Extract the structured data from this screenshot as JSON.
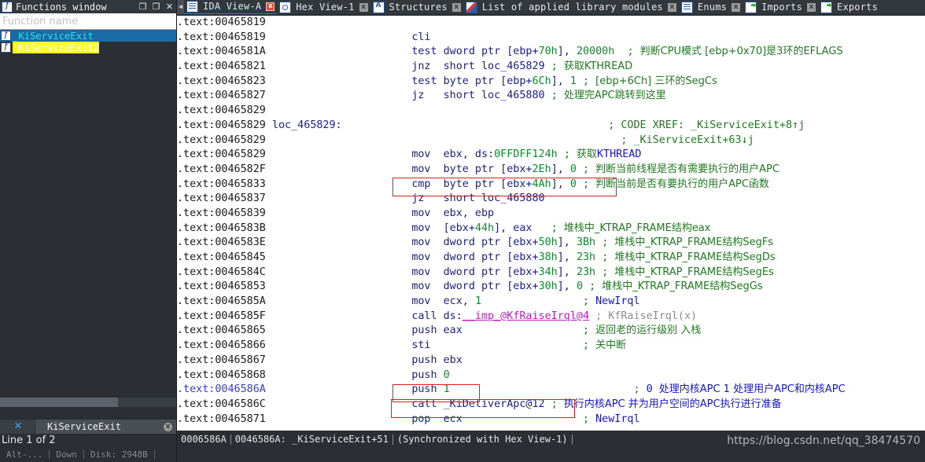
{
  "tabs": [
    {
      "label": "IDA View-A",
      "icon": "doc-icon",
      "active": true,
      "close": "x",
      "close_style": "red"
    },
    {
      "label": "Hex View-1",
      "icon": "hex-icon",
      "active": false,
      "close": "x",
      "close_style": "grey"
    },
    {
      "label": "Structures",
      "icon": "structures-icon",
      "active": false,
      "close": "x",
      "close_style": "grey"
    },
    {
      "label": "List of applied library modules",
      "icon": "library-icon",
      "active": false,
      "close": "x",
      "close_style": "grey"
    },
    {
      "label": "Enums",
      "icon": "enums-icon",
      "active": false,
      "close": "x",
      "close_style": "grey"
    },
    {
      "label": "Imports",
      "icon": "imports-icon",
      "active": false,
      "close": "x",
      "close_style": "grey"
    },
    {
      "label": "Exports",
      "icon": "exports-icon",
      "active": false,
      "close": "",
      "close_style": "none"
    }
  ],
  "tab_scroll_left": "◀",
  "functions_window": {
    "title": "Functions window",
    "icon": "function-icon",
    "buttons": {
      "restore": "❐",
      "maximize": "❐",
      "close": "✕"
    },
    "filter_placeholder": "Function name",
    "rows": [
      {
        "label": "_KiServiceExit",
        "selected": true,
        "highlight": "none"
      },
      {
        "label": "_KiServiceExit2",
        "selected": false,
        "highlight": "yellow"
      }
    ],
    "footer_tab": "KiServiceExit",
    "footer_close": "x",
    "footer_x": "✕"
  },
  "bottom_left": {
    "line_counter": "Line 1 of 2",
    "cells": [
      "Alt-...",
      "Down",
      "Disk: 2948B"
    ]
  },
  "statusbar": {
    "offset": "0006586A",
    "address": "0046586A: _KiServiceExit+51",
    "sync": "(Synchronized with Hex View-1)"
  },
  "watermark": "https://blog.csdn.net/qq_38474570",
  "disassembly": {
    "segment": ".text",
    "lines": [
      {
        "addr": "00465819",
        "parts": []
      },
      {
        "addr": "00465819",
        "parts": [
          {
            "t": "mn",
            "v": "cli"
          }
        ]
      },
      {
        "addr": "0046581A",
        "parts": [
          {
            "t": "mn",
            "v": "test"
          },
          {
            "t": "op",
            "v": "dword ptr [ebp+"
          },
          {
            "t": "num",
            "v": "70h"
          },
          {
            "t": "op",
            "v": "], "
          },
          {
            "t": "num",
            "v": "20000h"
          },
          {
            "t": "sp",
            "v": "  "
          },
          {
            "t": "cmt",
            "v": "; "
          },
          {
            "t": "zh",
            "v": "判断CPU模式 [ebp+0x70]是3环的EFLAGS"
          }
        ]
      },
      {
        "addr": "00465821",
        "parts": [
          {
            "t": "mn",
            "v": "jnz"
          },
          {
            "t": "loc",
            "v": "short loc_465829"
          },
          {
            "t": "sp",
            "v": " "
          },
          {
            "t": "cmt",
            "v": "; "
          },
          {
            "t": "zh",
            "v": "获取KTHREAD"
          }
        ]
      },
      {
        "addr": "00465823",
        "parts": [
          {
            "t": "mn",
            "v": "test"
          },
          {
            "t": "op",
            "v": "byte ptr [ebp+"
          },
          {
            "t": "num",
            "v": "6Ch"
          },
          {
            "t": "op",
            "v": "], "
          },
          {
            "t": "num",
            "v": "1"
          },
          {
            "t": "sp",
            "v": " "
          },
          {
            "t": "cmt",
            "v": "; "
          },
          {
            "t": "zh",
            "v": "[ebp+6Ch] 三环的SegCs"
          }
        ]
      },
      {
        "addr": "00465827",
        "parts": [
          {
            "t": "mn",
            "v": "jz"
          },
          {
            "t": "loc",
            "v": "short loc_465880"
          },
          {
            "t": "sp",
            "v": " "
          },
          {
            "t": "cmt",
            "v": "; "
          },
          {
            "t": "zh",
            "v": "处理完APC跳转到这里"
          }
        ]
      },
      {
        "addr": "00465829",
        "parts": []
      },
      {
        "addr": "00465829",
        "parts": [
          {
            "t": "labeldef",
            "v": "loc_465829:"
          },
          {
            "t": "xref",
            "v": "; CODE XREF: _KiServiceExit+8↑j"
          }
        ]
      },
      {
        "addr": "00465829",
        "parts": [
          {
            "t": "xref2",
            "v": "; _KiServiceExit+63↓j"
          }
        ]
      },
      {
        "addr": "00465829",
        "parts": [
          {
            "t": "mn",
            "v": "mov"
          },
          {
            "t": "op",
            "v": "ebx, ds:"
          },
          {
            "t": "num",
            "v": "0FFDFF124h"
          },
          {
            "t": "sp",
            "v": " "
          },
          {
            "t": "cmt",
            "v": "; "
          },
          {
            "t": "zh",
            "v": "获取"
          },
          {
            "t": "cmtblue",
            "v": "KTHREAD"
          }
        ]
      },
      {
        "addr": "0046582F",
        "parts": [
          {
            "t": "mn",
            "v": "mov"
          },
          {
            "t": "op",
            "v": "byte ptr [ebx+"
          },
          {
            "t": "num",
            "v": "2Eh"
          },
          {
            "t": "op",
            "v": "], "
          },
          {
            "t": "num",
            "v": "0"
          },
          {
            "t": "sp",
            "v": " "
          },
          {
            "t": "cmt",
            "v": "; "
          },
          {
            "t": "zh",
            "v": "判断当前线程是否有需要执行的用户APC"
          }
        ]
      },
      {
        "addr": "00465833",
        "parts": [
          {
            "t": "mn",
            "v": "cmp"
          },
          {
            "t": "op",
            "v": "byte ptr [ebx+"
          },
          {
            "t": "num",
            "v": "4Ah"
          },
          {
            "t": "op",
            "v": "], "
          },
          {
            "t": "num",
            "v": "0"
          },
          {
            "t": "sp",
            "v": " "
          },
          {
            "t": "cmt",
            "v": "; "
          },
          {
            "t": "zh",
            "v": "判断当前是否有要执行的用户APC函数"
          }
        ]
      },
      {
        "addr": "00465837",
        "parts": [
          {
            "t": "mn",
            "v": "jz"
          },
          {
            "t": "loc",
            "v": "short loc_465880"
          }
        ]
      },
      {
        "addr": "00465839",
        "parts": [
          {
            "t": "mn",
            "v": "mov"
          },
          {
            "t": "op",
            "v": "ebx, ebp"
          }
        ]
      },
      {
        "addr": "0046583B",
        "parts": [
          {
            "t": "mn",
            "v": "mov"
          },
          {
            "t": "op",
            "v": "[ebx+"
          },
          {
            "t": "num",
            "v": "44h"
          },
          {
            "t": "op",
            "v": "], eax"
          },
          {
            "t": "sp",
            "v": "   "
          },
          {
            "t": "cmt",
            "v": "; "
          },
          {
            "t": "zh",
            "v": "堆栈中_KTRAP_FRAME结构eax"
          }
        ]
      },
      {
        "addr": "0046583E",
        "parts": [
          {
            "t": "mn",
            "v": "mov"
          },
          {
            "t": "op",
            "v": "dword ptr [ebx+"
          },
          {
            "t": "num",
            "v": "50h"
          },
          {
            "t": "op",
            "v": "], "
          },
          {
            "t": "num",
            "v": "3Bh"
          },
          {
            "t": "sp",
            "v": " "
          },
          {
            "t": "cmt",
            "v": "; "
          },
          {
            "t": "zh",
            "v": "堆栈中_KTRAP_FRAME结构SegFs"
          }
        ]
      },
      {
        "addr": "00465845",
        "parts": [
          {
            "t": "mn",
            "v": "mov"
          },
          {
            "t": "op",
            "v": "dword ptr [ebx+"
          },
          {
            "t": "num",
            "v": "38h"
          },
          {
            "t": "op",
            "v": "], "
          },
          {
            "t": "num",
            "v": "23h"
          },
          {
            "t": "sp",
            "v": " "
          },
          {
            "t": "cmt",
            "v": "; "
          },
          {
            "t": "zh",
            "v": "堆栈中_KTRAP_FRAME结构SegDs"
          }
        ]
      },
      {
        "addr": "0046584C",
        "parts": [
          {
            "t": "mn",
            "v": "mov"
          },
          {
            "t": "op",
            "v": "dword ptr [ebx+"
          },
          {
            "t": "num",
            "v": "34h"
          },
          {
            "t": "op",
            "v": "], "
          },
          {
            "t": "num",
            "v": "23h"
          },
          {
            "t": "sp",
            "v": " "
          },
          {
            "t": "cmt",
            "v": "; "
          },
          {
            "t": "zh",
            "v": "堆栈中_KTRAP_FRAME结构SegEs"
          }
        ]
      },
      {
        "addr": "00465853",
        "parts": [
          {
            "t": "mn",
            "v": "mov"
          },
          {
            "t": "op",
            "v": "dword ptr [ebx+"
          },
          {
            "t": "num",
            "v": "30h"
          },
          {
            "t": "op",
            "v": "], "
          },
          {
            "t": "num",
            "v": "0"
          },
          {
            "t": "sp",
            "v": " "
          },
          {
            "t": "cmt",
            "v": "; "
          },
          {
            "t": "zh",
            "v": "堆栈中_KTRAP_FRAME结构SegGs"
          }
        ]
      },
      {
        "addr": "0046585A",
        "parts": [
          {
            "t": "mn",
            "v": "mov"
          },
          {
            "t": "op",
            "v": "ecx, "
          },
          {
            "t": "num",
            "v": "1"
          },
          {
            "t": "pad",
            "v": "NewIrql_pad"
          },
          {
            "t": "cmt",
            "v": "; "
          },
          {
            "t": "cmtblue",
            "v": "NewIrql"
          }
        ]
      },
      {
        "addr": "0046585F",
        "parts": [
          {
            "t": "mn",
            "v": "call"
          },
          {
            "t": "op",
            "v": "ds:"
          },
          {
            "t": "imp",
            "v": "__imp_@KfRaiseIrql@4"
          },
          {
            "t": "sp",
            "v": " "
          },
          {
            "t": "gry",
            "v": "; KfRaiseIrql(x)"
          }
        ]
      },
      {
        "addr": "00465865",
        "parts": [
          {
            "t": "mn",
            "v": "push"
          },
          {
            "t": "op",
            "v": "eax"
          },
          {
            "t": "pad",
            "v": "cmt_pad"
          },
          {
            "t": "cmt",
            "v": "; "
          },
          {
            "t": "zh",
            "v": "返回老的运行级别 入栈"
          }
        ]
      },
      {
        "addr": "00465866",
        "parts": [
          {
            "t": "mn",
            "v": "sti"
          },
          {
            "t": "pad",
            "v": "cmt_pad"
          },
          {
            "t": "cmt",
            "v": "; "
          },
          {
            "t": "zh",
            "v": "关中断"
          }
        ]
      },
      {
        "addr": "00465867",
        "parts": [
          {
            "t": "mn",
            "v": "push"
          },
          {
            "t": "op",
            "v": "ebx"
          }
        ]
      },
      {
        "addr": "00465868",
        "parts": [
          {
            "t": "mn",
            "v": "push"
          },
          {
            "t": "num",
            "v": "0"
          }
        ]
      },
      {
        "addr": "0046586A",
        "current": true,
        "parts": [
          {
            "t": "mn",
            "v": "push"
          },
          {
            "t": "num",
            "v": "1"
          },
          {
            "t": "pad",
            "v": "cmt_pad2"
          },
          {
            "t": "cmt",
            "v": "; "
          },
          {
            "t": "cmtblue",
            "v": "0 "
          },
          {
            "t": "zhblue",
            "v": "处理内核APC 1 处理用户APC和内核APC"
          }
        ]
      },
      {
        "addr": "0046586C",
        "parts": [
          {
            "t": "mn",
            "v": "call"
          },
          {
            "t": "imp2",
            "v": "_KiDeliverApc@12"
          },
          {
            "t": "sp",
            "v": " "
          },
          {
            "t": "cmt",
            "v": "; "
          },
          {
            "t": "zhblue",
            "v": "执行内核APC 并为用户空间的APC执行进行准备"
          }
        ]
      },
      {
        "addr": "00465871",
        "parts": [
          {
            "t": "mn",
            "v": "pop"
          },
          {
            "t": "op",
            "v": "ecx"
          },
          {
            "t": "pad",
            "v": "NewIrql_pad"
          },
          {
            "t": "cmt",
            "v": "; "
          },
          {
            "t": "cmtblue",
            "v": "NewIrql"
          }
        ]
      }
    ],
    "annotations": [
      {
        "name": "cmp-highlight-box",
        "color": "#e01b1b"
      },
      {
        "name": "push-1-highlight-box",
        "color": "#e01b1b"
      },
      {
        "name": "call-kideliverapc-highlight-box",
        "color": "#e01b1b"
      }
    ]
  }
}
